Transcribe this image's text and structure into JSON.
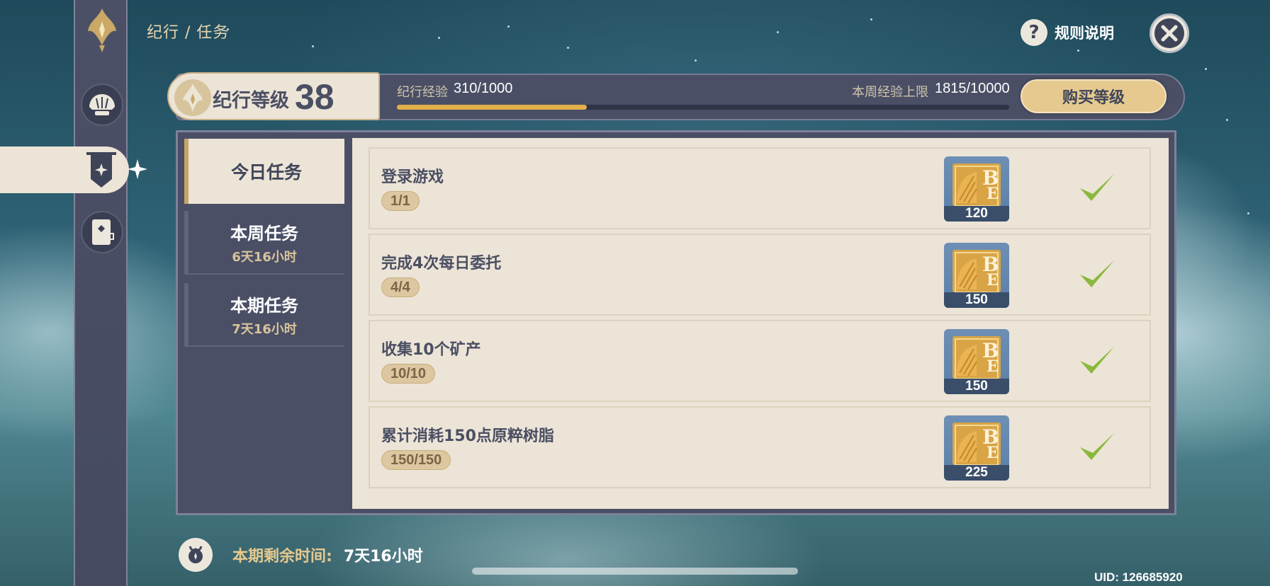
{
  "breadcrumb": "纪行 / 任务",
  "header": {
    "rules_label": "规则说明",
    "rules_icon": "question-icon",
    "close_icon": "close-icon"
  },
  "level": {
    "label": "纪行等级",
    "value": "38",
    "exp_label": "纪行经验",
    "exp_value": "310/1000",
    "exp_progress": 0.31,
    "weekly_cap_label": "本周经验上限",
    "weekly_cap_value": "1815/10000",
    "buy_label": "购买等级"
  },
  "tabs": [
    {
      "label": "今日任务",
      "sub": ""
    },
    {
      "label": "本周任务",
      "sub": "6天16小时"
    },
    {
      "label": "本期任务",
      "sub": "7天16小时"
    }
  ],
  "tasks": [
    {
      "name": "登录游戏",
      "progress": "1/1",
      "reward_qty": "120",
      "completed": true
    },
    {
      "name": "完成4次每日委托",
      "progress": "4/4",
      "reward_qty": "150",
      "completed": true
    },
    {
      "name": "收集10个矿产",
      "progress": "10/10",
      "reward_qty": "150",
      "completed": true
    },
    {
      "name": "累计消耗150点原粹树脂",
      "progress": "150/150",
      "reward_qty": "225",
      "completed": true
    }
  ],
  "footer": {
    "remaining_label": "本期剩余时间:",
    "remaining_value": "7天16小时",
    "uid": "UID: 126685920"
  },
  "colors": {
    "panel": "#4a4f66",
    "card": "#ece4d6",
    "accent_gold": "#e5c98f",
    "exp_fill": "#e2b04a",
    "check_green": "#8ab83c"
  }
}
